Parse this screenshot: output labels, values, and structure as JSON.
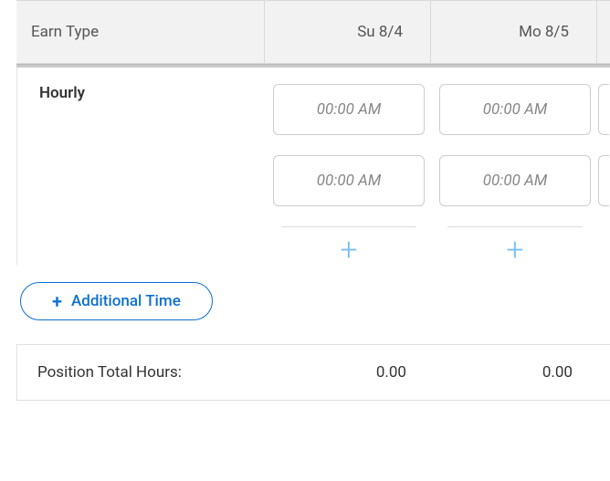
{
  "header": {
    "earn_type_label": "Earn Type",
    "days": [
      "Su 8/4",
      "Mo 8/5"
    ]
  },
  "row": {
    "earn_type": "Hourly",
    "time_placeholder": "00:00 AM"
  },
  "actions": {
    "additional_time_label": "Additional Time"
  },
  "totals": {
    "label": "Position Total Hours:",
    "values": [
      "0.00",
      "0.00"
    ]
  }
}
